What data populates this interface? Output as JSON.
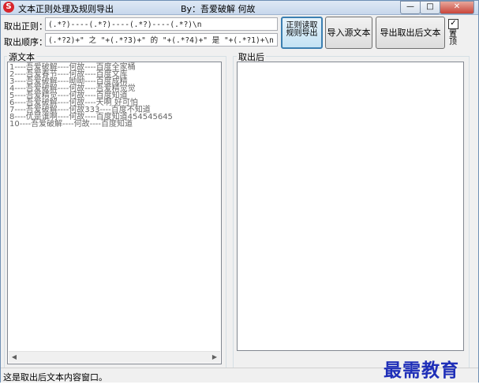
{
  "window": {
    "title": "文本正则处理及规则导出",
    "author": "By：吾爱破解 何故",
    "minimize": "—",
    "maximize": "□",
    "close": "✕"
  },
  "regex": {
    "extract_label": "取出正则：",
    "extract_value": "(.*?)----(.*?)----(.*?)----(.*?)\\n",
    "order_label": "取出顺序：",
    "order_value": "(.*?2)+\" 之 \"+(.*?3)+\" 的 \"+(.*?4)+\" 是 \"+(.*?1)+\\n"
  },
  "buttons": {
    "regex_read_export": "正则读取\n规则导出",
    "import_source": "导入源文本",
    "export_result": "导出取出后文本",
    "topmost_label": "置顶",
    "topmost_checked": true
  },
  "source": {
    "title": "源文本",
    "lines": [
      "1----吾爱破解----何故----百度全家桶",
      "2----吾爱春节----何故----百度文库",
      "3----吾爱破解----呦呦----百度成精",
      "4----吾爱破解----何故----吾爱精觉觉",
      "5----吾爱精觉----何故----百度知道",
      "6----吾爱破解----何故----天啊 好可怕",
      "7----吾爱破解----何故333----百度不知道",
      "8----优是谁啊----何故----百度知道454545645",
      "10----吾爱破解----何故----百度知道"
    ]
  },
  "result": {
    "title": "取出后",
    "lines": []
  },
  "status": {
    "text": "这是取出后文本内容窗口。"
  },
  "watermark": "最需教育"
}
